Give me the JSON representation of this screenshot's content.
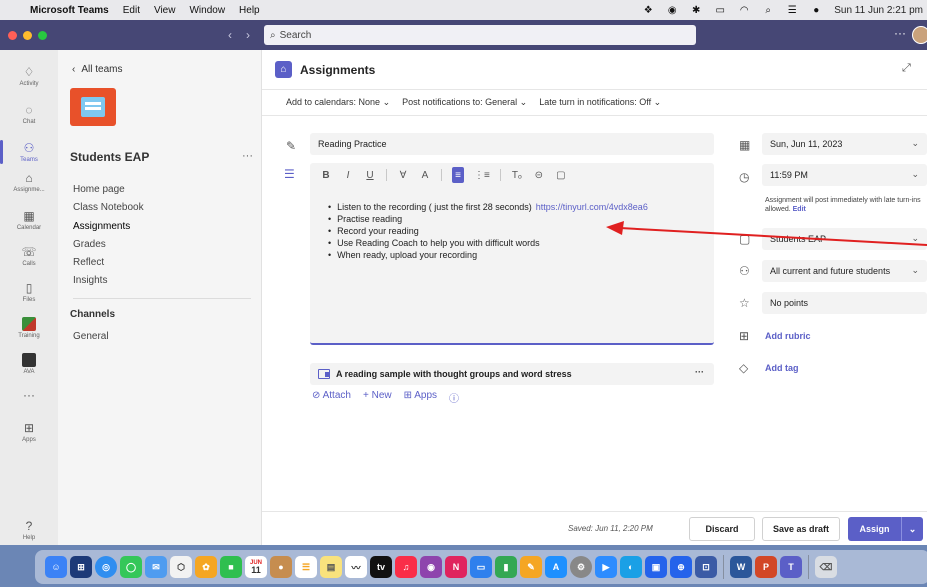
{
  "menubar": {
    "app_name": "Microsoft Teams",
    "items": [
      "Edit",
      "View",
      "Window",
      "Help"
    ],
    "datetime": "Sun 11 Jun  2:21 pm"
  },
  "titlebar": {
    "search_placeholder": "Search",
    "more": "···"
  },
  "rail": {
    "items": [
      {
        "label": "Activity",
        "icon": "bell-icon"
      },
      {
        "label": "Chat",
        "icon": "chat-icon"
      },
      {
        "label": "Teams",
        "icon": "teams-icon"
      },
      {
        "label": "Assignme...",
        "icon": "assignments-icon"
      },
      {
        "label": "Calendar",
        "icon": "calendar-icon"
      },
      {
        "label": "Calls",
        "icon": "phone-icon"
      },
      {
        "label": "Files",
        "icon": "file-icon"
      },
      {
        "label": "Training",
        "icon": "training-icon"
      },
      {
        "label": "AVA",
        "icon": "ava-icon"
      },
      {
        "label": "···",
        "icon": "more-icon"
      },
      {
        "label": "Apps",
        "icon": "apps-icon"
      },
      {
        "label": "Help",
        "icon": "help-icon"
      }
    ]
  },
  "teampanel": {
    "back_label": "All teams",
    "team_name": "Students EAP",
    "more": "···",
    "nav": [
      "Home page",
      "Class Notebook",
      "Assignments",
      "Grades",
      "Reflect",
      "Insights"
    ],
    "channels_heading": "Channels",
    "channels": [
      "General"
    ]
  },
  "main": {
    "title": "Assignments",
    "subbar": {
      "calendar": "Add to calendars: None",
      "notifications": "Post notifications to: General",
      "late": "Late turn in notifications: Off"
    },
    "assignment_title": "Reading Practice",
    "toolbar": [
      "B",
      "I",
      "U",
      "∀",
      "A",
      "≡",
      "⋮≡",
      "Tₒ",
      "⊝",
      "▢"
    ],
    "instructions": [
      "Listen to the recording ( just the first 28 seconds)",
      "Practise reading",
      "Record your reading",
      "Use Reading Coach to help you with difficult words",
      "When ready, upload your recording"
    ],
    "instructions_link": "https://tinyurl.com/4vdx8ea6",
    "resource_title": "A reading sample with thought groups and word stress",
    "resource_more": "···",
    "attach": {
      "attach": "Attach",
      "new": "New",
      "apps": "Apps"
    }
  },
  "right": {
    "due_date": "Sun, Jun 11, 2023",
    "due_time": "11:59 PM",
    "note": "Assignment will post immediately with late turn-ins allowed.",
    "note_edit": "Edit",
    "class": "Students EAP",
    "students": "All current and future students",
    "points": "No points",
    "rubric": "Add rubric",
    "tag": "Add tag"
  },
  "footer": {
    "saved": "Saved: Jun 11, 2:20 PM",
    "discard": "Discard",
    "save_draft": "Save as draft",
    "assign": "Assign"
  },
  "colors": {
    "accent": "#5b5fc7",
    "titlebar": "#464775",
    "annotation": "#e02020"
  },
  "dock": {
    "calendar_month": "JUN",
    "calendar_day": "11"
  }
}
